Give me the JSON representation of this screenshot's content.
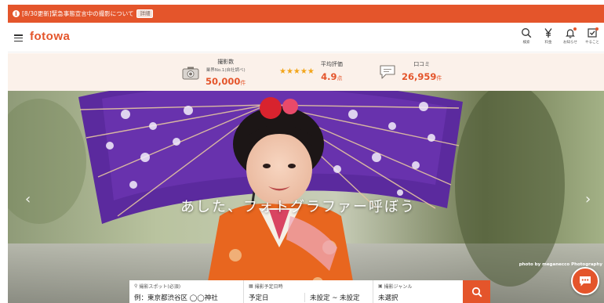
{
  "notice": {
    "text": "[8/30更新]緊急事態宣言中の撮影について",
    "badge": "詳細"
  },
  "header": {
    "logo": "fotowa",
    "icons": [
      {
        "name": "search-icon",
        "label": "検索"
      },
      {
        "name": "yen-icon",
        "label": "料金"
      },
      {
        "name": "bell-icon",
        "label": "お知らせ"
      },
      {
        "name": "todo-icon",
        "label": "やること"
      }
    ]
  },
  "stats": {
    "shots": {
      "label": "撮影数",
      "sub": "業界No.1(自社調べ)",
      "value": "50,000",
      "unit": "件"
    },
    "rating": {
      "label": "平均評価",
      "stars": "★★★★★",
      "value": "4.9",
      "unit": "点"
    },
    "reviews": {
      "label": "口コミ",
      "value": "26,959",
      "unit": "件"
    }
  },
  "hero": {
    "tagline": "あした、フォトグラファー呼ぼう",
    "credit": "photo by meganecco Photography",
    "prev": "‹",
    "next": "›"
  },
  "search": {
    "spot_label": "撮影スポット(必須)",
    "spot_placeholder": "例：東京都渋谷区 ◯◯神社",
    "date_label": "撮影予定日時",
    "date_value": "予定日",
    "time_value": "未設定 ~ 未設定",
    "genre_label": "撮影ジャンル",
    "genre_value": "未選択"
  },
  "colors": {
    "brand": "#e4552b",
    "band": "#fbf1ea",
    "star": "#f2a51a"
  }
}
